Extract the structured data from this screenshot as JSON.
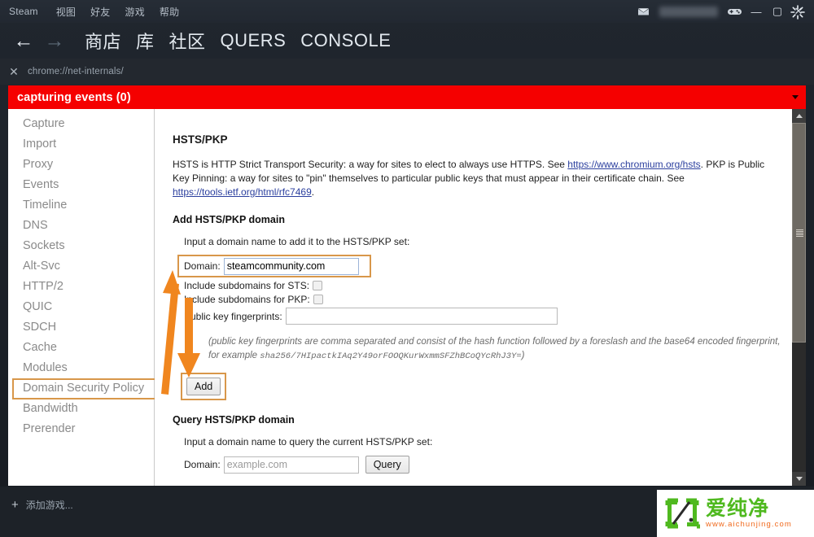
{
  "steam": {
    "menu": [
      "Steam",
      "视图",
      "好友",
      "游戏",
      "帮助"
    ],
    "nav": {
      "back_icon": "arrow-left-icon",
      "forward_icon": "arrow-right-icon",
      "links": [
        "商店",
        "库",
        "社区",
        "QUERS",
        "CONSOLE"
      ]
    },
    "tray": {
      "mail_icon": "envelope-icon",
      "username": "",
      "gamepad_icon": "gamepad-icon"
    },
    "window_controls": {
      "minimize": "—",
      "maximize": "▢",
      "close": "✕"
    },
    "bottom": {
      "add_game_label": "添加游戏...",
      "plus_icon": "plus-icon"
    }
  },
  "browser": {
    "close_tab_icon": "close-icon",
    "url": "chrome://net-internals/",
    "spinner_icon": "loading-spinner-icon"
  },
  "capture_banner": {
    "text": "capturing events (0)",
    "color": "#f50000",
    "caret_icon": "chevron-down-icon"
  },
  "sidebar": {
    "items": [
      {
        "label": "Capture",
        "selected": false
      },
      {
        "label": "Import",
        "selected": false
      },
      {
        "label": "Proxy",
        "selected": false
      },
      {
        "label": "Events",
        "selected": false
      },
      {
        "label": "Timeline",
        "selected": false
      },
      {
        "label": "DNS",
        "selected": false
      },
      {
        "label": "Sockets",
        "selected": false
      },
      {
        "label": "Alt-Svc",
        "selected": false
      },
      {
        "label": "HTTP/2",
        "selected": false
      },
      {
        "label": "QUIC",
        "selected": false
      },
      {
        "label": "SDCH",
        "selected": false
      },
      {
        "label": "Cache",
        "selected": false
      },
      {
        "label": "Modules",
        "selected": false
      },
      {
        "label": "Domain Security Policy",
        "selected": true
      },
      {
        "label": "Bandwidth",
        "selected": false
      },
      {
        "label": "Prerender",
        "selected": false
      }
    ]
  },
  "main": {
    "title": "HSTS/PKP",
    "intro_part1": "HSTS is HTTP Strict Transport Security: a way for sites to elect to always use HTTPS. See ",
    "intro_link1": "https://www.chromium.org/hsts",
    "intro_part2": ". PKP is Public Key Pinning: a way for sites to \"pin\" themselves to particular public keys that must appear in their certificate chain. See ",
    "intro_link2": "https://tools.ietf.org/html/rfc7469",
    "intro_part3": ".",
    "add_section": {
      "heading": "Add HSTS/PKP domain",
      "lead": "Input a domain name to add it to the HSTS/PKP set:",
      "domain_label": "Domain:",
      "domain_value": "steamcommunity.com",
      "sts_label": "Include subdomains for STS:",
      "sts_checked": false,
      "pkp_label": "Include subdomains for PKP:",
      "pkp_checked": false,
      "fingerprints_label": "Public key fingerprints:",
      "fingerprints_value": "",
      "note_text": "(public key fingerprints are comma separated and consist of the hash function followed by a foreslash and the base64 encoded fingerprint, for example ",
      "note_mono": "sha256/7HIpactkIAq2Y49orFOOQKurWxmmSFZhBCoQYcRhJ3Y=",
      "note_close": ")",
      "add_button": "Add"
    },
    "query_section": {
      "heading": "Query HSTS/PKP domain",
      "lead": "Input a domain name to query the current HSTS/PKP set:",
      "domain_label": "Domain:",
      "domain_placeholder": "example.com",
      "query_button": "Query"
    }
  },
  "annotations": {
    "highlight_color": "#d8974a",
    "arrow_color": "#f0861f",
    "arrow_from_sidebar_to_domain": "diagonal-arrow-up-right",
    "arrow_down_to_add": "arrow-down"
  },
  "watermark": {
    "brand": "爱纯净",
    "url": "www.aichunjing.com",
    "brand_color": "#4fb91f",
    "url_color": "#f06a1e"
  },
  "scrollbar": {
    "up_icon": "triangle-up-icon",
    "down_icon": "triangle-down-icon",
    "grip_icon": "grip-icon"
  }
}
